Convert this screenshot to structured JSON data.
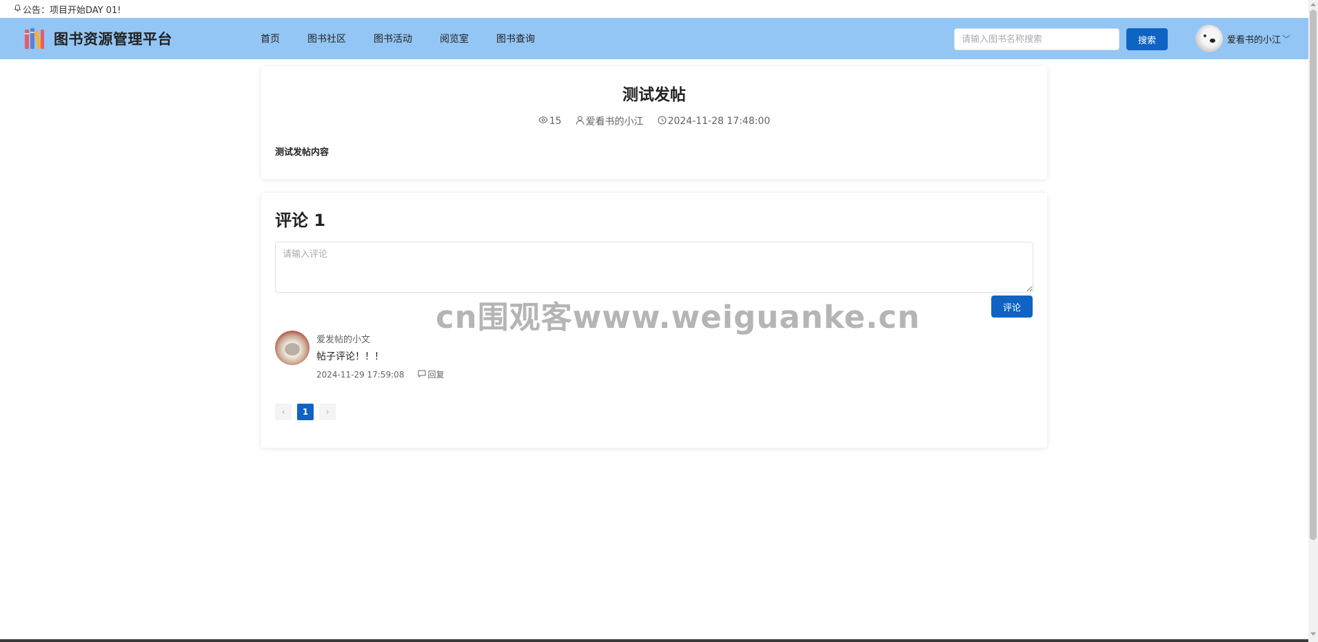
{
  "notice": {
    "text": "公告：项目开始DAY 01!"
  },
  "header": {
    "title": "图书资源管理平台",
    "nav": [
      "首页",
      "图书社区",
      "图书活动",
      "阅览室",
      "图书查询"
    ],
    "search": {
      "placeholder": "请输入图书名称搜索",
      "button": "搜索"
    },
    "user": {
      "name": "爱看书的小江",
      "caret": "﹀"
    }
  },
  "post": {
    "title": "测试发帖",
    "views": "15",
    "author": "爱看书的小江",
    "time": "2024-11-28 17:48:00",
    "content": "测试发帖内容"
  },
  "comments": {
    "heading": "评论 1",
    "input_placeholder": "请输入评论",
    "submit": "评论",
    "items": [
      {
        "author": "爱发帖的小文",
        "text": "帖子评论！！！",
        "time": "2024-11-29 17:59:08",
        "reply": "回复"
      }
    ],
    "pager": {
      "prev": "‹",
      "current": "1",
      "next": "›"
    }
  },
  "watermark": "cn围观客www.weiguanke.cn",
  "colors": {
    "header_bg": "#93c6f4",
    "primary": "#0f63c2"
  }
}
